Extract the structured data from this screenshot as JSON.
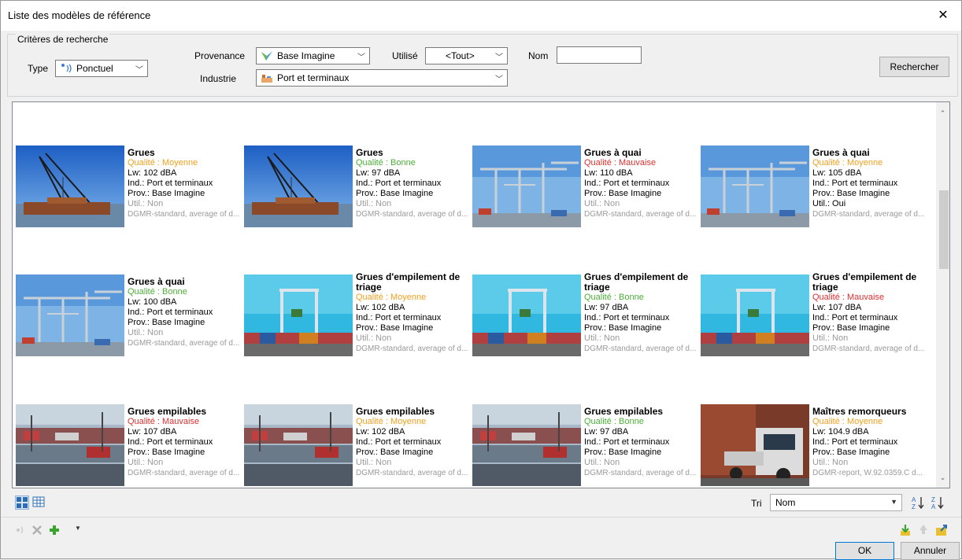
{
  "window": {
    "title": "Liste des modèles de référence",
    "close": "✕"
  },
  "criteria": {
    "legend": "Critères de recherche",
    "type_label": "Type",
    "type_value": "Ponctuel",
    "provenance_label": "Provenance",
    "provenance_value": "Base Imagine",
    "utilise_label": "Utilisé",
    "utilise_value": "<Tout>",
    "nom_label": "Nom",
    "nom_value": "",
    "industrie_label": "Industrie",
    "industrie_value": "Port et terminaux",
    "search_button": "Rechercher"
  },
  "cards": [
    {
      "name": "Grues",
      "quality": "Qualité : Moyenne",
      "q": "moyenne",
      "lw": "Lw: 102 dBA",
      "ind": "Ind.: Port et terminaux",
      "prov": "Prov.: Base Imagine",
      "util": "Util.: Non",
      "util_active": false,
      "desc": "DGMR-standard, average of d...",
      "img": "crane-barge"
    },
    {
      "name": "Grues",
      "quality": "Qualité : Bonne",
      "q": "bonne",
      "lw": "Lw: 97 dBA",
      "ind": "Ind.: Port et terminaux",
      "prov": "Prov.: Base Imagine",
      "util": "Util.: Non",
      "util_active": false,
      "desc": "DGMR-standard, average of d...",
      "img": "crane-barge"
    },
    {
      "name": "Grues à quai",
      "quality": "Qualité : Mauvaise",
      "q": "mauvaise",
      "lw": "Lw: 110 dBA",
      "ind": "Ind.: Port et terminaux",
      "prov": "Prov.: Base Imagine",
      "util": "Util.: Non",
      "util_active": false,
      "desc": "DGMR-standard, average of d...",
      "img": "quay-crane"
    },
    {
      "name": "Grues à quai",
      "quality": "Qualité : Moyenne",
      "q": "moyenne",
      "lw": "Lw: 105 dBA",
      "ind": "Ind.: Port et terminaux",
      "prov": "Prov.: Base Imagine",
      "util": "Util.: Oui",
      "util_active": true,
      "desc": "DGMR-standard, average of d...",
      "img": "quay-crane"
    },
    {
      "name": "Grues à quai",
      "quality": "Qualité : Bonne",
      "q": "bonne",
      "lw": "Lw: 100 dBA",
      "ind": "Ind.: Port et terminaux",
      "prov": "Prov.: Base Imagine",
      "util": "Util.: Non",
      "util_active": false,
      "desc": "DGMR-standard, average of d...",
      "img": "quay-crane"
    },
    {
      "name": "Grues d'empilement de triage",
      "quality": "Qualité : Moyenne",
      "q": "moyenne",
      "lw": "Lw: 102 dBA",
      "ind": "Ind.: Port et terminaux",
      "prov": "Prov.: Base Imagine",
      "util": "Util.: Non",
      "util_active": false,
      "desc": "DGMR-standard, average of d...",
      "img": "gantry"
    },
    {
      "name": "Grues d'empilement de triage",
      "quality": "Qualité : Bonne",
      "q": "bonne",
      "lw": "Lw: 97 dBA",
      "ind": "Ind.: Port et terminaux",
      "prov": "Prov.: Base Imagine",
      "util": "Util.: Non",
      "util_active": false,
      "desc": "DGMR-standard, average of d...",
      "img": "gantry"
    },
    {
      "name": "Grues d'empilement de triage",
      "quality": "Qualité : Mauvaise",
      "q": "mauvaise",
      "lw": "Lw: 107 dBA",
      "ind": "Ind.: Port et terminaux",
      "prov": "Prov.: Base Imagine",
      "util": "Util.: Non",
      "util_active": false,
      "desc": "DGMR-standard, average of d...",
      "img": "gantry"
    },
    {
      "name": "Grues empilables",
      "quality": "Qualité : Mauvaise",
      "q": "mauvaise",
      "lw": "Lw: 107 dBA",
      "ind": "Ind.: Port et terminaux",
      "prov": "Prov.: Base Imagine",
      "util": "Util.: Non",
      "util_active": false,
      "desc": "DGMR-standard, average of d...",
      "img": "yard"
    },
    {
      "name": "Grues empilables",
      "quality": "Qualité : Moyenne",
      "q": "moyenne",
      "lw": "Lw: 102 dBA",
      "ind": "Ind.: Port et terminaux",
      "prov": "Prov.: Base Imagine",
      "util": "Util.: Non",
      "util_active": false,
      "desc": "DGMR-standard, average of d...",
      "img": "yard"
    },
    {
      "name": "Grues empilables",
      "quality": "Qualité : Bonne",
      "q": "bonne",
      "lw": "Lw: 97 dBA",
      "ind": "Ind.: Port et terminaux",
      "prov": "Prov.: Base Imagine",
      "util": "Util.: Non",
      "util_active": false,
      "desc": "DGMR-standard, average of d...",
      "img": "yard"
    },
    {
      "name": "Maîtres remorqueurs",
      "quality": "Qualité : Moyenne",
      "q": "moyenne",
      "lw": "Lw: 104.9 dBA",
      "ind": "Ind.: Port et terminaux",
      "prov": "Prov.: Base Imagine",
      "util": "Util.: Non",
      "util_active": false,
      "desc": "DGMR-report, W.92.0359.C d...",
      "img": "truck"
    }
  ],
  "sort": {
    "label": "Tri",
    "value": "Nom"
  },
  "footer": {
    "ok": "OK",
    "cancel": "Annuler"
  },
  "icons": {
    "view_grid": "grid-view-icon",
    "view_table": "table-view-icon",
    "sort_az": "sort-ascending-icon",
    "sort_za": "sort-descending-icon",
    "delete": "delete-icon",
    "add": "add-icon",
    "import": "import-icon",
    "export": "export-icon"
  },
  "colors": {
    "moyenne": "#f0a020",
    "bonne": "#4caf38",
    "mauvaise": "#e03030"
  }
}
